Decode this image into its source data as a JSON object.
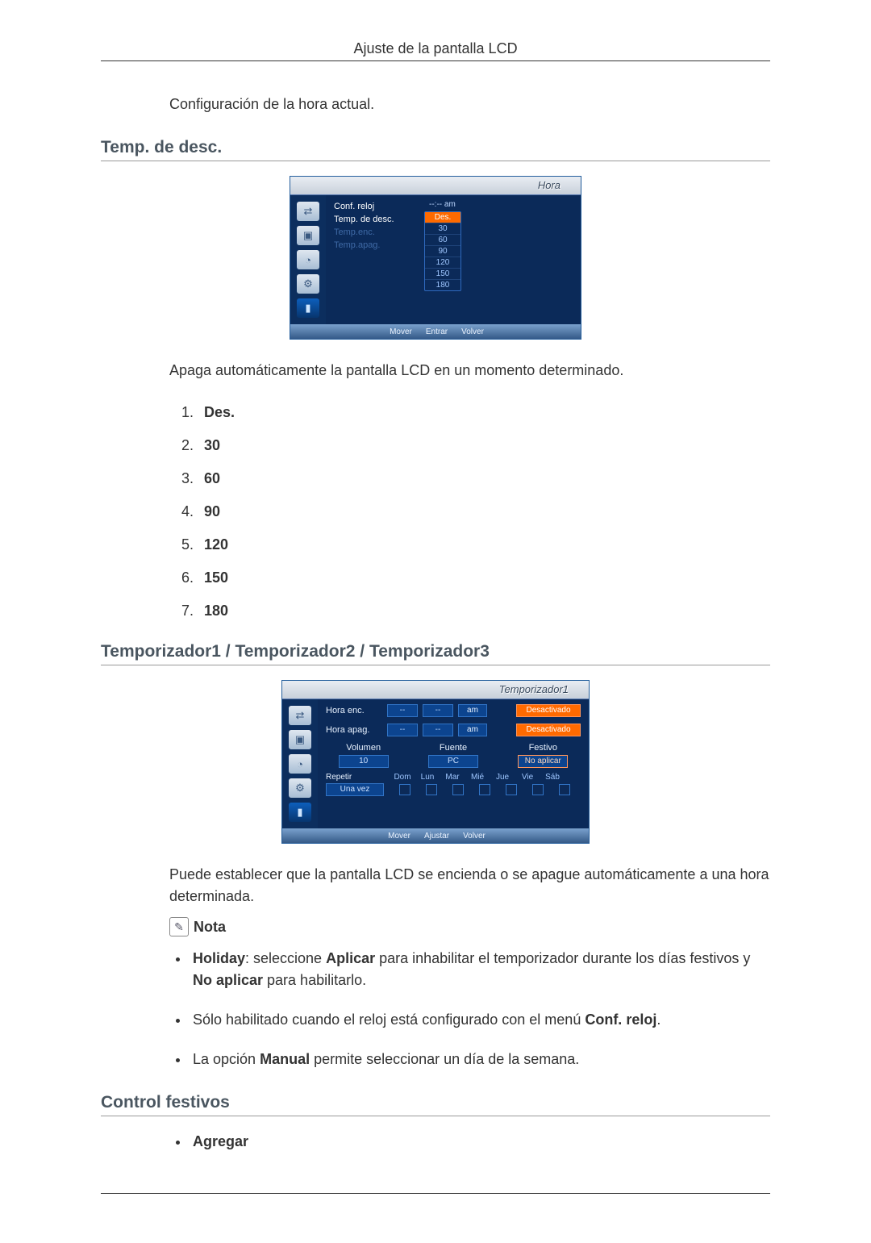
{
  "header": {
    "title": "Ajuste de la pantalla LCD"
  },
  "intro_line": "Configuración de la hora actual.",
  "section1": {
    "heading": "Temp. de desc.",
    "osd": {
      "title": "Hora",
      "menu": {
        "conf_reloj": "Conf. reloj",
        "temp_de_desc": "Temp. de desc.",
        "temp_enc": "Temp.enc.",
        "temp_apag": "Temp.apag."
      },
      "clock_value": "--:-- am",
      "options": [
        "Des.",
        "30",
        "60",
        "90",
        "120",
        "150",
        "180"
      ],
      "footer": {
        "mover": "Mover",
        "entrar": "Entrar",
        "volver": "Volver"
      }
    },
    "desc": "Apaga automáticamente la pantalla LCD en un momento determinado.",
    "list": [
      "Des.",
      "30",
      "60",
      "90",
      "120",
      "150",
      "180"
    ]
  },
  "section2": {
    "heading": "Temporizador1 / Temporizador2 / Temporizador3",
    "osd": {
      "title": "Temporizador1",
      "hora_enc": {
        "label": "Hora enc.",
        "hh": "--",
        "mm": "--",
        "ampm": "am",
        "state": "Desactivado"
      },
      "hora_apag": {
        "label": "Hora apag.",
        "hh": "--",
        "mm": "--",
        "ampm": "am",
        "state": "Desactivado"
      },
      "cols": {
        "volumen": {
          "label": "Volumen",
          "value": "10"
        },
        "fuente": {
          "label": "Fuente",
          "value": "PC"
        },
        "festivo": {
          "label": "Festivo",
          "value": "No aplicar"
        }
      },
      "repetir": {
        "label": "Repetir",
        "value": "Una vez",
        "days": [
          "Dom",
          "Lun",
          "Mar",
          "Mié",
          "Jue",
          "Vie",
          "Sáb"
        ]
      },
      "footer": {
        "mover": "Mover",
        "ajustar": "Ajustar",
        "volver": "Volver"
      }
    },
    "desc": "Puede establecer que la pantalla LCD se encienda o se apague automáticamente a una hora determinada.",
    "note_label": "Nota",
    "notes": {
      "n1_a": "Holiday",
      "n1_b": ": seleccione ",
      "n1_c": "Aplicar",
      "n1_d": " para inhabilitar el temporizador durante los días festivos y ",
      "n1_e": "No aplicar",
      "n1_f": " para habilitarlo.",
      "n2_a": "Sólo habilitado cuando el reloj está configurado con el menú ",
      "n2_b": "Conf. reloj",
      "n2_c": ".",
      "n3_a": "La opción ",
      "n3_b": "Manual",
      "n3_c": " permite seleccionar un día de la semana."
    }
  },
  "section3": {
    "heading": "Control festivos",
    "items": [
      "Agregar"
    ]
  }
}
